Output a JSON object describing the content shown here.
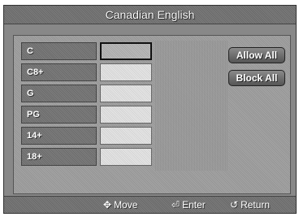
{
  "title": "Canadian English",
  "ratings": [
    {
      "label": "C",
      "selected": true
    },
    {
      "label": "C8+",
      "selected": false
    },
    {
      "label": "G",
      "selected": false
    },
    {
      "label": "PG",
      "selected": false
    },
    {
      "label": "14+",
      "selected": false
    },
    {
      "label": "18+",
      "selected": false
    }
  ],
  "buttons": {
    "allow_all": "Allow All",
    "block_all": "Block All"
  },
  "footer": {
    "move": "Move",
    "enter": "Enter",
    "return": "Return"
  },
  "icons": {
    "move": "four-way-arrow-icon",
    "enter": "enter-icon",
    "return": "return-icon"
  }
}
